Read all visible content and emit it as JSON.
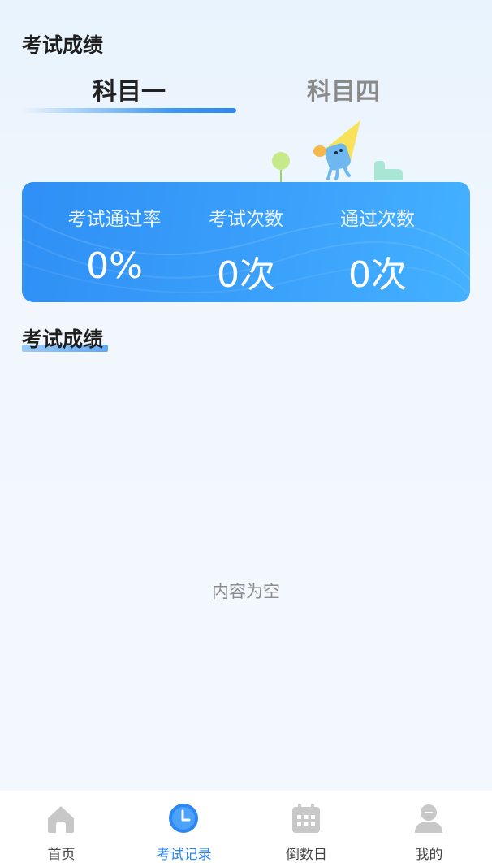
{
  "header": {
    "title": "考试成绩"
  },
  "subject_tabs": [
    {
      "label": "科目一",
      "active": true
    },
    {
      "label": "科目四",
      "active": false
    }
  ],
  "stats": [
    {
      "label": "考试通过率",
      "value": "0%"
    },
    {
      "label": "考试次数",
      "value": "0次"
    },
    {
      "label": "通过次数",
      "value": "0次"
    }
  ],
  "section": {
    "title": "考试成绩",
    "empty_text": "内容为空"
  },
  "tabbar": [
    {
      "label": "首页",
      "icon": "home-icon",
      "active": false
    },
    {
      "label": "考试记录",
      "icon": "clock-icon",
      "active": true
    },
    {
      "label": "倒数日",
      "icon": "calendar-icon",
      "active": false
    },
    {
      "label": "我的",
      "icon": "user-icon",
      "active": false
    }
  ],
  "colors": {
    "accent": "#2e86f2",
    "card": "#3a9cf8",
    "inactive_icon": "#c8c8c8"
  }
}
